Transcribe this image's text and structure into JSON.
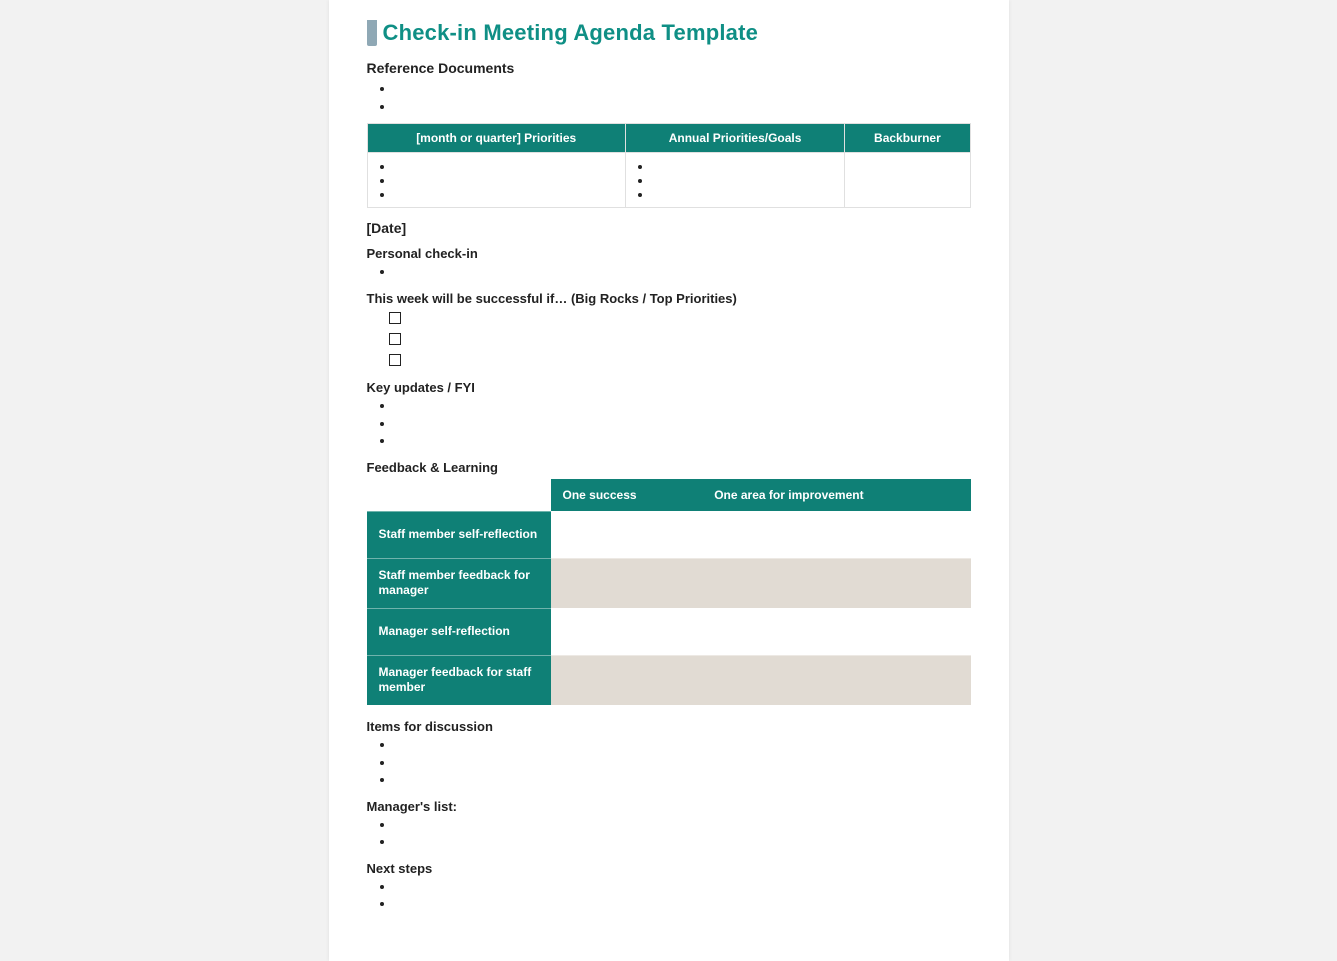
{
  "title": "Check-in Meeting Agenda Template",
  "sections": {
    "reference_docs_heading": "Reference Documents",
    "priorities_table": {
      "headers": [
        "[month or quarter] Priorities",
        "Annual Priorities/Goals",
        "Backburner"
      ]
    },
    "date_heading": "[Date]",
    "personal_checkin": "Personal check-in",
    "successful_week": "This week will be successful if… (Big Rocks / Top Priorities)",
    "key_updates": "Key updates / FYI",
    "feedback_learning": "Feedback & Learning",
    "feedback_table": {
      "col1": "One success",
      "col2": "One area for improvement",
      "rows": [
        "Staff member self-reflection",
        "Staff member feedback for manager",
        "Manager self-reflection",
        "Manager feedback for staff member"
      ]
    },
    "items_discussion": "Items for discussion",
    "managers_list": "Manager's list:",
    "next_steps": "Next steps"
  }
}
